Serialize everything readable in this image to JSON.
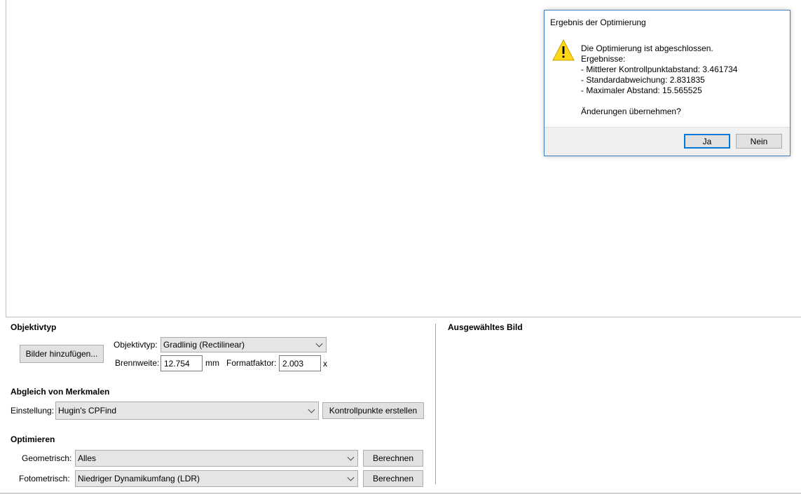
{
  "dialog": {
    "title": "Ergebnis der Optimierung",
    "lines": [
      "Die Optimierung ist abgeschlossen.",
      "Ergebnisse:",
      "- Mittlerer Kontrollpunktabstand: 3.461734",
      "- Standardabweichung: 2.831835",
      "- Maximaler Abstand: 15.565525",
      "",
      "Änderungen übernehmen?"
    ],
    "yes_label": "Ja",
    "no_label": "Nein",
    "icon": "warning-icon"
  },
  "lens": {
    "section_title": "Objektivtyp",
    "add_images_label": "Bilder hinzufügen...",
    "type_label": "Objektivtyp:",
    "type_value": "Gradlinig (Rectilinear)",
    "focal_label": "Brennweite:",
    "focal_value": "12.754",
    "focal_unit": "mm",
    "crop_label": "Formatfaktor:",
    "crop_value": "2.003",
    "crop_unit": "x"
  },
  "matching": {
    "section_title": "Abgleich von Merkmalen",
    "setting_label": "Einstellung:",
    "setting_value": "Hugin's CPFind",
    "create_label": "Kontrollpunkte erstellen"
  },
  "optimize": {
    "section_title": "Optimieren",
    "geometric_label": "Geometrisch:",
    "geometric_value": "Alles",
    "geometric_button": "Berechnen",
    "photometric_label": "Fotometrisch:",
    "photometric_value": "Niedriger Dynamikumfang (LDR)",
    "photometric_button": "Berechnen"
  },
  "selected_image": {
    "section_title": "Ausgewähltes Bild"
  },
  "colors": {
    "dialog_border": "#3b7fc4",
    "default_button_border": "#0078d7",
    "warning_fill": "#ffd81a"
  }
}
